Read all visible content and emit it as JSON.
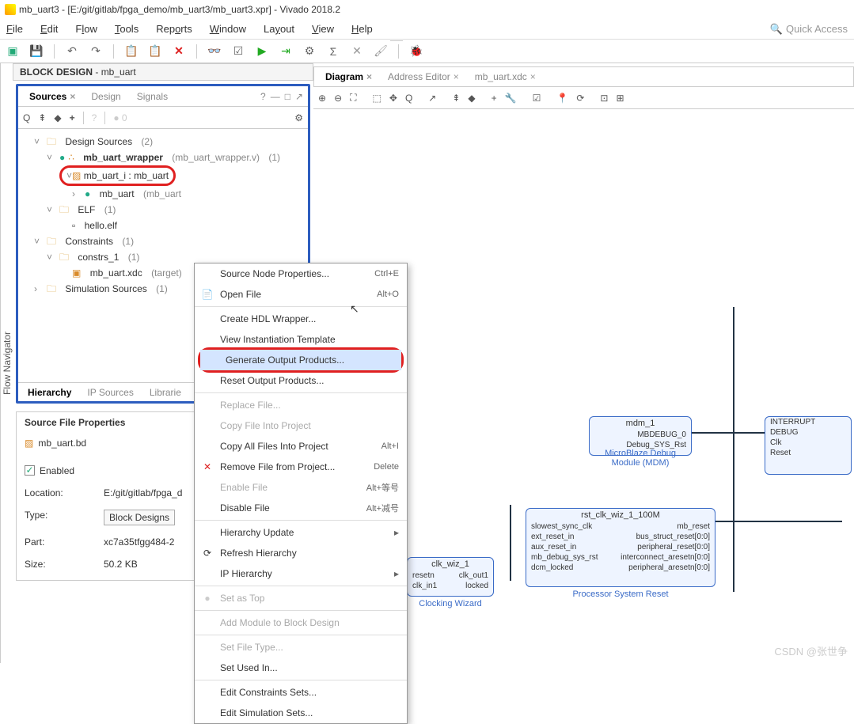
{
  "window": {
    "title": "mb_uart3 - [E:/git/gitlab/fpga_demo/mb_uart3/mb_uart3.xpr] - Vivado 2018.2"
  },
  "menus": {
    "file": "File",
    "edit": "Edit",
    "flow": "Flow",
    "tools": "Tools",
    "reports": "Reports",
    "window": "Window",
    "layout": "Layout",
    "view": "View",
    "help": "Help",
    "quick": "Quick Access"
  },
  "block_header": {
    "label": "BLOCK DESIGN",
    "name": "mb_uart"
  },
  "flow_nav": "Flow Navigator",
  "sources": {
    "tab_sources": "Sources",
    "tab_design": "Design",
    "tab_signals": "Signals",
    "design_sources": "Design Sources",
    "design_count": "(2)",
    "wrapper": "mb_uart_wrapper",
    "wrapper_file": "(mb_uart_wrapper.v)",
    "wrapper_count": "(1)",
    "inst": "mb_uart_i : mb_uart",
    "inner": "mb_uart",
    "inner_file": "(mb_uart",
    "elf": "ELF",
    "elf_count": "(1)",
    "hello": "hello.elf",
    "constraints": "Constraints",
    "constraints_count": "(1)",
    "constrs": "constrs_1",
    "constrs_count": "(1)",
    "xdc": "mb_uart.xdc",
    "xdc_target": "(target)",
    "sim": "Simulation Sources",
    "sim_count": "(1)",
    "btab_hier": "Hierarchy",
    "btab_ip": "IP Sources",
    "btab_lib": "Librarie"
  },
  "props": {
    "header": "Source File Properties",
    "file": "mb_uart.bd",
    "enabled": "Enabled",
    "loc_lbl": "Location:",
    "loc_val": "E:/git/gitlab/fpga_d",
    "type_lbl": "Type:",
    "type_val": "Block Designs",
    "part_lbl": "Part:",
    "part_val": "xc7a35tfgg484-2",
    "size_lbl": "Size:",
    "size_val": "50.2 KB"
  },
  "right_tabs": {
    "diagram": "Diagram",
    "addr": "Address Editor",
    "xdc": "mb_uart.xdc"
  },
  "ctx": {
    "node_props": "Source Node Properties...",
    "node_sc": "Ctrl+E",
    "open": "Open File",
    "open_sc": "Alt+O",
    "hdl": "Create HDL Wrapper...",
    "viewinst": "View Instantiation Template",
    "gen": "Generate Output Products...",
    "reset": "Reset Output Products...",
    "replace": "Replace File...",
    "copyinto": "Copy File Into Project",
    "copyall": "Copy All Files Into Project",
    "copyall_sc": "Alt+I",
    "remove": "Remove File from Project...",
    "remove_sc": "Delete",
    "enable": "Enable File",
    "enable_sc": "Alt+等号",
    "disable": "Disable File",
    "disable_sc": "Alt+减号",
    "hier_upd": "Hierarchy Update",
    "refresh": "Refresh Hierarchy",
    "iphier": "IP Hierarchy",
    "settop": "Set as Top",
    "addmod": "Add Module to Block Design",
    "setft": "Set File Type...",
    "setused": "Set Used In...",
    "editc": "Edit Constraints Sets...",
    "edits": "Edit Simulation Sets..."
  },
  "blocks": {
    "mdm": {
      "name": "mdm_1",
      "p1": "MBDEBUG_0",
      "p2": "Debug_SYS_Rst",
      "cap": "MicroBlaze Debug Module (MDM)"
    },
    "intr": {
      "p1": "INTERRUPT",
      "p2": "DEBUG",
      "p3": "Clk",
      "p4": "Reset"
    },
    "clkwiz": {
      "name": "clk_wiz_1",
      "l1": "resetn",
      "l2": "clk_in1",
      "r1": "clk_out1",
      "r2": "locked",
      "cap": "Clocking Wizard"
    },
    "rst": {
      "name": "rst_clk_wiz_1_100M",
      "l1": "slowest_sync_clk",
      "l2": "ext_reset_in",
      "l3": "aux_reset_in",
      "l4": "mb_debug_sys_rst",
      "l5": "dcm_locked",
      "r1": "mb_reset",
      "r2": "bus_struct_reset[0:0]",
      "r3": "peripheral_reset[0:0]",
      "r4": "interconnect_aresetn[0:0]",
      "r5": "peripheral_aresetn[0:0]",
      "cap": "Processor System Reset"
    }
  },
  "watermark": "CSDN @张世争"
}
